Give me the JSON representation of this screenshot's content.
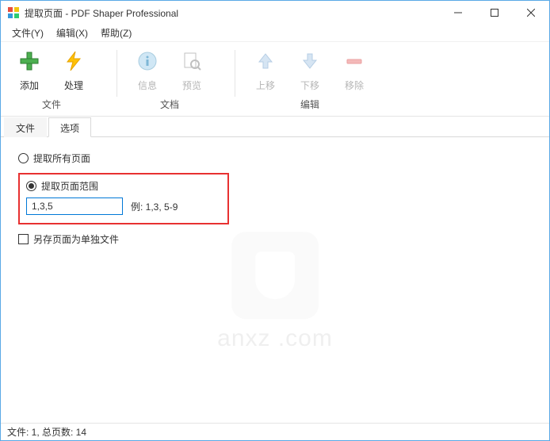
{
  "titlebar": {
    "title": "提取页面 - PDF Shaper Professional"
  },
  "menu": {
    "file": "文件(Y)",
    "edit": "编辑(X)",
    "help": "帮助(Z)"
  },
  "toolbar": {
    "add": "添加",
    "process": "处理",
    "info": "信息",
    "preview": "预览",
    "moveup": "上移",
    "movedown": "下移",
    "remove": "移除",
    "group_file": "文件",
    "group_doc": "文档",
    "group_edit": "编辑"
  },
  "tabs": {
    "files": "文件",
    "options": "选项"
  },
  "options": {
    "radio_all": "提取所有页面",
    "radio_range": "提取页面范围",
    "range_value": "1,3,5",
    "range_example": "例: 1,3, 5-9",
    "save_separate": "另存页面为单独文件"
  },
  "status": {
    "text": "文件: 1, 总页数: 14"
  },
  "watermark": {
    "text": "anxz .com"
  }
}
